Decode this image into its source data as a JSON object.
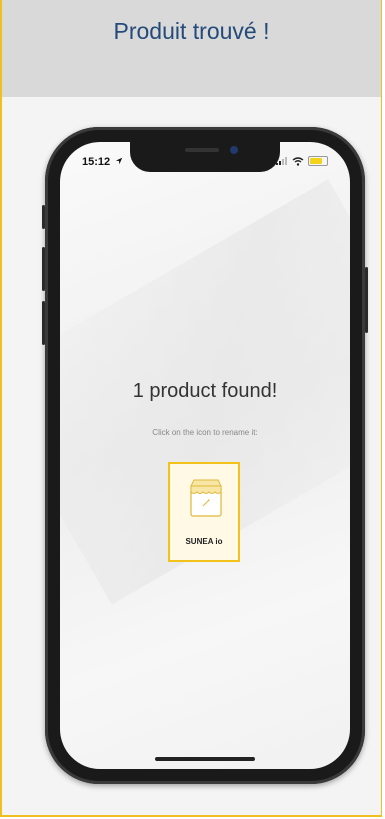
{
  "header": {
    "title": "Produit trouvé !"
  },
  "phone": {
    "status": {
      "time": "15:12"
    },
    "main": {
      "title": "1 product found!",
      "subtitle": "Click on the icon to rename it:",
      "product": {
        "label": "SUNEA io",
        "icon": "store-awning-icon"
      }
    }
  },
  "colors": {
    "accent": "#f0c020",
    "title": "#244a7a"
  }
}
